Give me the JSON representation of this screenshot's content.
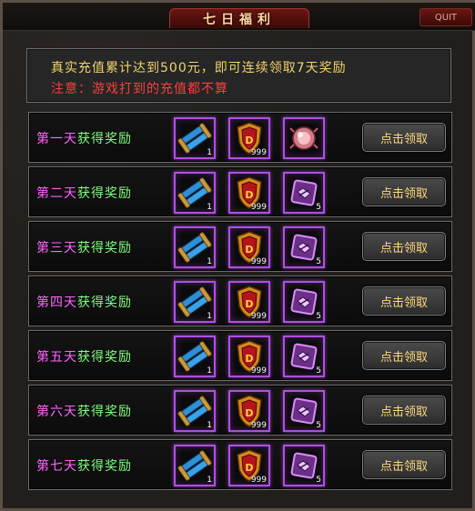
{
  "window": {
    "title": "七日福利",
    "quit_label": "QUIT"
  },
  "notice": {
    "line1": "真实充值累计达到500元，即可连续领取7天奖励",
    "line2": "注意：游戏打到的充值都不算",
    "colors": {
      "line1": "#f2d36a",
      "line2": "#ff3d3d"
    }
  },
  "claim_button_label": "点击领取",
  "rows": [
    {
      "day": "第一天",
      "suffix": "获得奖励",
      "button": "点击领取",
      "items": [
        {
          "icon": "scroll-icon",
          "qty": "1"
        },
        {
          "icon": "shield-icon",
          "qty": "999"
        },
        {
          "icon": "gem-orb-icon",
          "qty": ""
        }
      ]
    },
    {
      "day": "第二天",
      "suffix": "获得奖励",
      "button": "点击领取",
      "items": [
        {
          "icon": "scroll-icon",
          "qty": "1"
        },
        {
          "icon": "shield-icon",
          "qty": "999"
        },
        {
          "icon": "rune-book-icon",
          "qty": "5"
        }
      ]
    },
    {
      "day": "第三天",
      "suffix": "获得奖励",
      "button": "点击领取",
      "items": [
        {
          "icon": "scroll-icon",
          "qty": "1"
        },
        {
          "icon": "shield-icon",
          "qty": "999"
        },
        {
          "icon": "rune-book-icon",
          "qty": "5"
        }
      ]
    },
    {
      "day": "第四天",
      "suffix": "获得奖励",
      "button": "点击领取",
      "items": [
        {
          "icon": "scroll-icon",
          "qty": "1"
        },
        {
          "icon": "shield-icon",
          "qty": "999"
        },
        {
          "icon": "rune-book-icon",
          "qty": "5"
        }
      ]
    },
    {
      "day": "第五天",
      "suffix": "获得奖励",
      "button": "点击领取",
      "items": [
        {
          "icon": "scroll-icon",
          "qty": "1"
        },
        {
          "icon": "shield-icon",
          "qty": "999"
        },
        {
          "icon": "rune-book-icon",
          "qty": "5"
        }
      ]
    },
    {
      "day": "第六天",
      "suffix": "获得奖励",
      "button": "点击领取",
      "items": [
        {
          "icon": "scroll-icon",
          "qty": "1"
        },
        {
          "icon": "shield-icon",
          "qty": "999"
        },
        {
          "icon": "rune-book-icon",
          "qty": "5"
        }
      ]
    },
    {
      "day": "第七天",
      "suffix": "获得奖励",
      "button": "点击领取",
      "items": [
        {
          "icon": "scroll-icon",
          "qty": "1"
        },
        {
          "icon": "shield-icon",
          "qty": "999"
        },
        {
          "icon": "rune-book-icon",
          "qty": "5"
        }
      ]
    }
  ],
  "colors": {
    "day_text": "#ff63ff",
    "reward_text": "#7fff7f",
    "button_text": "#ffd780",
    "item_border": "#b04fe0",
    "title_text": "#ffd7a0"
  }
}
